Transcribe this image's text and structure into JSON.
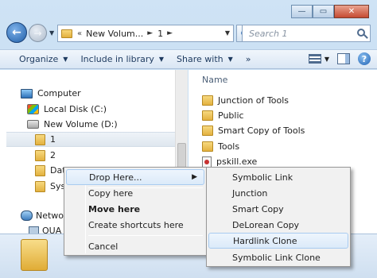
{
  "window": {
    "caption": {
      "minimize": "—",
      "maximize": "▭",
      "close": "✕"
    }
  },
  "nav": {
    "back_glyph": "←",
    "forward_glyph": "→",
    "history_glyph": "▼",
    "breadcrumb_sep": "«",
    "breadcrumbs": [
      "New Volum...",
      "1"
    ],
    "crumb_arrow": "►",
    "refresh_glyph": "⟳",
    "search_placeholder": "Search 1"
  },
  "toolbar": {
    "organize": "Organize",
    "include_in_library": "Include in library",
    "share_with": "Share with",
    "more": "»",
    "help": "?"
  },
  "tree": [
    {
      "label": "Computer",
      "icon": "computer-icon"
    },
    {
      "label": "Local Disk (C:)",
      "icon": "drive-icon"
    },
    {
      "label": "New Volume (D:)",
      "icon": "drive-icon"
    },
    {
      "label": "1",
      "icon": "folder-icon",
      "selected": true
    },
    {
      "label": "2",
      "icon": "folder-icon"
    },
    {
      "label": "Dat",
      "icon": "folder-icon"
    },
    {
      "label": "Sys",
      "icon": "folder-icon"
    },
    {
      "label": "Netwo",
      "icon": "network-icon"
    },
    {
      "label": "QUA",
      "icon": "share-icon"
    }
  ],
  "content": {
    "column_header": "Name",
    "files": [
      {
        "label": "Junction of Tools",
        "icon": "folder-icon"
      },
      {
        "label": "Public",
        "icon": "folder-icon"
      },
      {
        "label": "Smart Copy of Tools",
        "icon": "folder-icon"
      },
      {
        "label": "Tools",
        "icon": "folder-icon"
      },
      {
        "label": "pskill.exe",
        "icon": "exe-icon"
      }
    ]
  },
  "context_menu": {
    "items": [
      {
        "label": "Drop Here...",
        "submenu": true
      },
      {
        "label": "Copy here"
      },
      {
        "label": "Move here",
        "bold": true
      },
      {
        "label": "Create shortcuts here"
      },
      {
        "label": "Cancel"
      }
    ],
    "submenu_glyph": "▶"
  },
  "submenu": {
    "items": [
      {
        "label": "Symbolic Link"
      },
      {
        "label": "Junction"
      },
      {
        "label": "Smart Copy"
      },
      {
        "label": "DeLorean Copy"
      },
      {
        "label": "Hardlink Clone",
        "highlighted": true
      },
      {
        "label": "Symbolic Link Clone"
      }
    ]
  },
  "colors": {
    "accent": "#2d71b8",
    "highlight_border": "#a8cbf0",
    "folder": "#e3b13f"
  }
}
